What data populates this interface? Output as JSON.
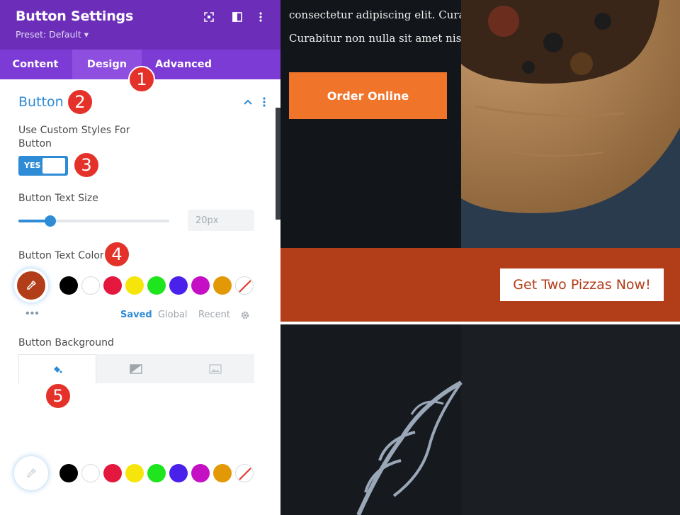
{
  "panel": {
    "title": "Button Settings",
    "preset": "Preset: Default ▾",
    "header_color": "#6c2eb9",
    "accent_color": "#2e8bd6"
  },
  "tabs": [
    {
      "label": "Content",
      "active": false
    },
    {
      "label": "Design",
      "active": true
    },
    {
      "label": "Advanced",
      "active": false
    }
  ],
  "section": {
    "title": "Button",
    "custom_styles_label_line1": "Use Custom Styles For",
    "custom_styles_label_line2": "Button",
    "toggle_value": "YES",
    "text_size_label": "Button Text Size",
    "text_size_value": "20px",
    "text_size_slider_fraction": 0.2,
    "text_color_label": "Button Text Color",
    "selected_color": "#b23d19",
    "swatches": [
      "#000000",
      "#ffffff",
      "#e4173e",
      "#f5e50a",
      "#1ee51e",
      "#4a21ea",
      "#c50fc5",
      "#e39906",
      "none"
    ],
    "palette_tabs": [
      "Saved",
      "Global",
      "Recent"
    ],
    "palette_active": "Saved",
    "background_label": "Button Background",
    "background_tab_icons": [
      "paint-bucket-icon",
      "gradient-icon",
      "image-icon"
    ]
  },
  "badges": [
    "1",
    "2",
    "3",
    "4",
    "5"
  ],
  "preview": {
    "body_line1": "consectetur adipiscing elit. Curab",
    "body_line2": "Curabitur non nulla sit amet nisl",
    "order_button": "Order Online",
    "cta_button": "Get Two Pizzas Now!",
    "cta_background": "#b23d19",
    "order_color": "#f1742b"
  }
}
